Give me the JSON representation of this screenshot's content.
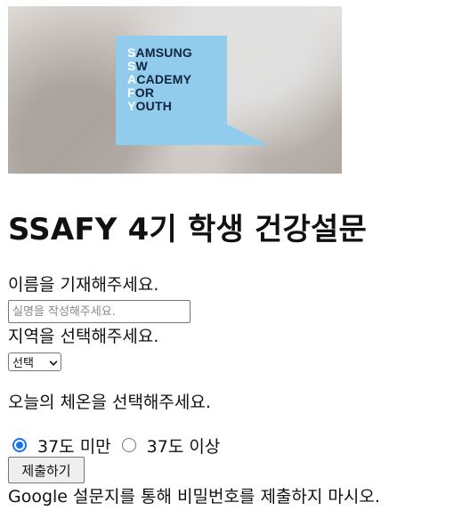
{
  "banner": {
    "logo_lines": [
      {
        "initial": "S",
        "rest": "AMSUNG"
      },
      {
        "initial": "S",
        "rest": "W"
      },
      {
        "initial": "A",
        "rest": "CADEMY"
      },
      {
        "initial": "F",
        "rest": "OR"
      },
      {
        "initial": "Y",
        "rest": "OUTH"
      }
    ],
    "logo_color": "#8ccdf2",
    "logo_text_color": "#0f2440"
  },
  "title": "SSAFY 4기 학생 건강설문",
  "form": {
    "name_label": "이름을 기재해주세요.",
    "name_placeholder": "실명을 작성해주세요.",
    "name_value": "",
    "region_label": "지역을 선택해주세요.",
    "region_selected": "선택",
    "temp_label": "오늘의 체온을 선택해주세요.",
    "temp_options": [
      {
        "label": "37도 미만",
        "checked": true
      },
      {
        "label": "37도 이상",
        "checked": false
      }
    ],
    "submit_label": "제출하기",
    "notice": "Google 설문지를 통해 비밀번호를 제출하지 마시오."
  },
  "colors": {
    "radio_accent": "#1a73e8",
    "button_bg": "#efefef"
  },
  "icons": {
    "select_arrow": "chevron-down-icon"
  }
}
